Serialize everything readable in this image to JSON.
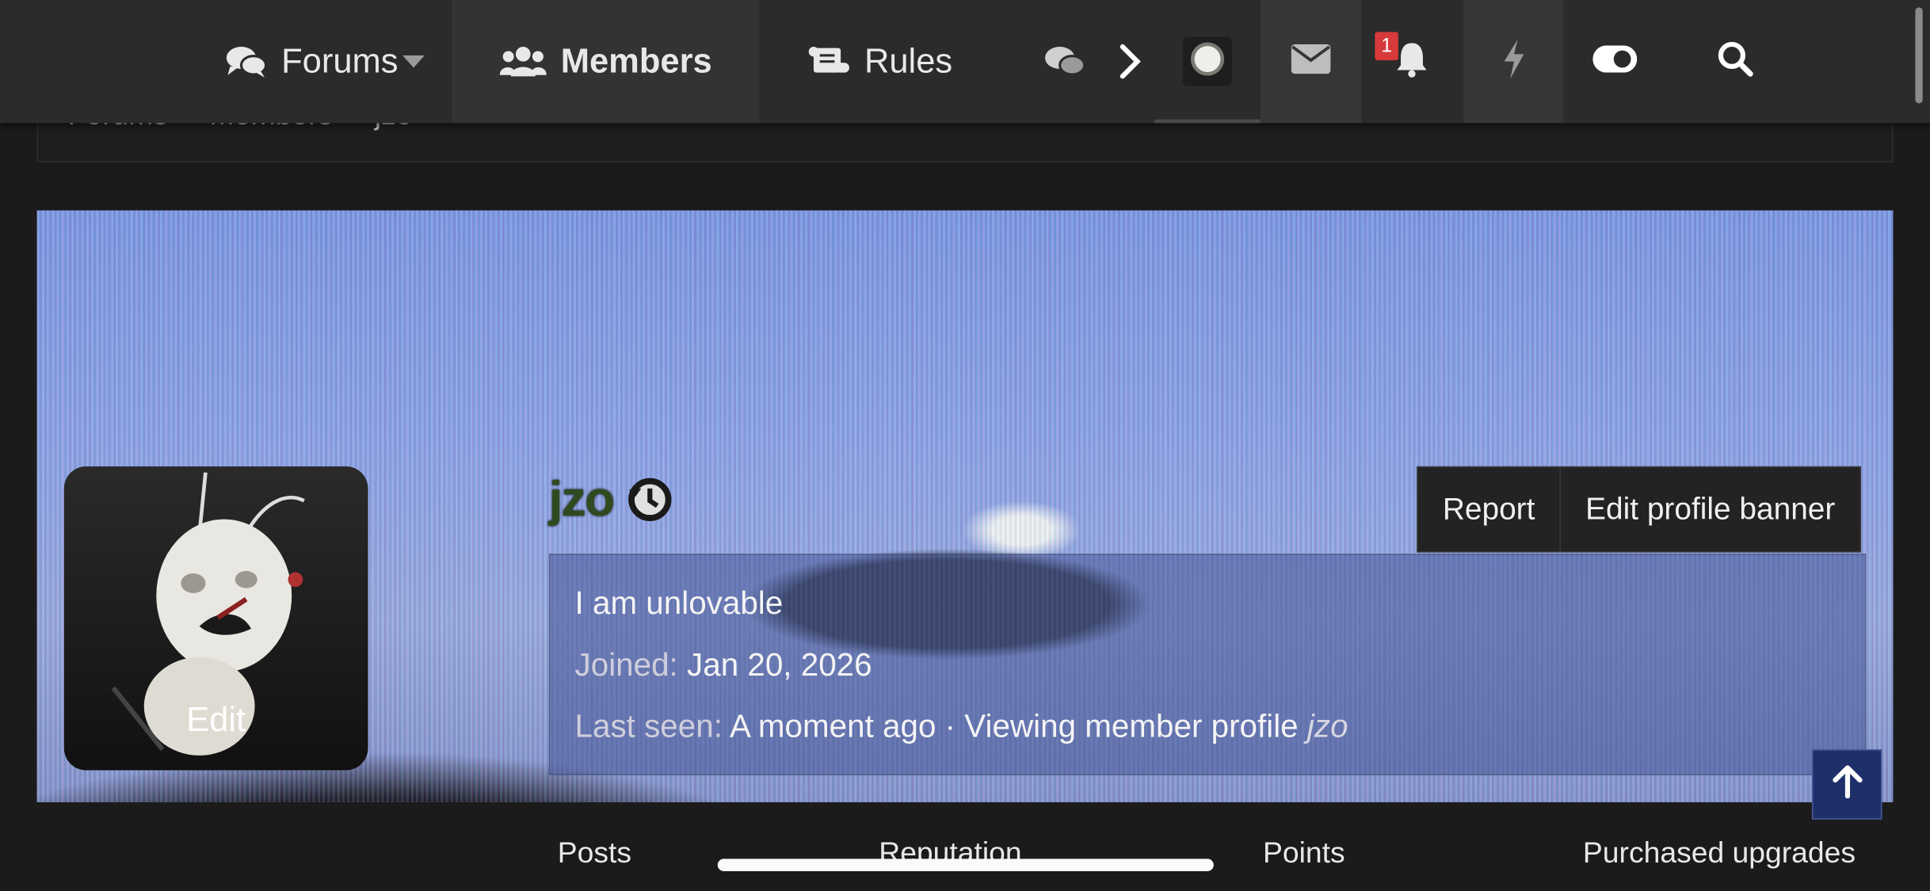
{
  "nav": {
    "forums_label": "Forums",
    "members_label": "Members",
    "rules_label": "Rules",
    "notification_count": "1",
    "icons": [
      "comments-icon",
      "users-icon",
      "scroll-icon",
      "chats-icon",
      "chevron-right-icon",
      "envelope-icon",
      "bell-icon",
      "bolt-icon",
      "toggle-icon",
      "search-icon"
    ]
  },
  "breadcrumb": [
    "Forums",
    "Members",
    "jzo"
  ],
  "profile": {
    "username": "jzo",
    "avatar_edit_label": "Edit",
    "status": "I am unlovable",
    "joined_label": "Joined:",
    "joined_value": "Jan 20, 2026",
    "last_seen_label": "Last seen:",
    "last_seen_value": "A moment ago · Viewing member profile",
    "last_seen_target": "jzo"
  },
  "actions": {
    "report_label": "Report",
    "edit_banner_label": "Edit profile banner"
  },
  "stats": {
    "posts_label": "Posts",
    "reputation_label": "Reputation",
    "points_label": "Points",
    "upgrades_label": "Purchased upgrades"
  },
  "colors": {
    "nav_bg": "#2b2b2b",
    "page_bg": "#1b1b1b",
    "badge": "#d63a3a",
    "username": "#2f4a1e",
    "scroll_top": "#1e2f6a"
  }
}
